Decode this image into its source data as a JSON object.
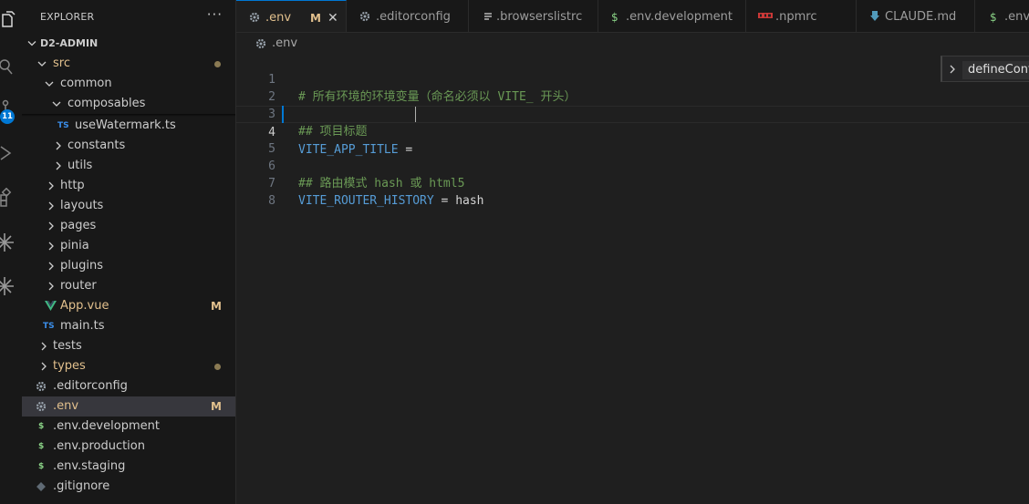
{
  "explorer": {
    "title": "EXPLORER",
    "more": "···",
    "project": "D2-ADMIN",
    "items": [
      {
        "label": "src",
        "modified": false
      },
      {
        "label": "common"
      },
      {
        "label": "composables"
      },
      {
        "label": "useWatermark.ts",
        "icon": "TS"
      },
      {
        "label": "constants"
      },
      {
        "label": "utils"
      },
      {
        "label": "http"
      },
      {
        "label": "layouts"
      },
      {
        "label": "pages"
      },
      {
        "label": "pinia"
      },
      {
        "label": "plugins"
      },
      {
        "label": "router"
      },
      {
        "label": "App.vue",
        "git": "M"
      },
      {
        "label": "main.ts",
        "icon": "TS"
      },
      {
        "label": "tests"
      },
      {
        "label": "types"
      },
      {
        "label": ".editorconfig"
      },
      {
        "label": ".env",
        "git": "M"
      },
      {
        "label": ".env.development",
        "icon": "$"
      },
      {
        "label": ".env.production",
        "icon": "$"
      },
      {
        "label": ".env.staging",
        "icon": "$"
      },
      {
        "label": ".gitignore"
      }
    ]
  },
  "activity": {
    "badge": "11"
  },
  "tabs": [
    {
      "label": ".env",
      "git": "M",
      "close": "✕",
      "icon": "gear-icon"
    },
    {
      "label": ".editorconfig",
      "icon": "gear-icon"
    },
    {
      "label": ".browserslistrc",
      "icon": "list-icon"
    },
    {
      "label": ".env.development",
      "icon": "$"
    },
    {
      "label": ".npmrc",
      "icon": "npm-icon"
    },
    {
      "label": "CLAUDE.md",
      "icon": "download-arrow-icon"
    },
    {
      "label": ".env.",
      "icon": "$"
    }
  ],
  "breadcrumb": {
    "file": ".env"
  },
  "editor": {
    "lines": [
      {
        "num": "1",
        "comment": "# 所有环境的环境变量（命名必须以 VITE_ 开头）"
      },
      {
        "num": "2"
      },
      {
        "num": "3",
        "comment": "## 项目标题"
      },
      {
        "num": "4",
        "var": "VITE_APP_TITLE",
        "rest": " ="
      },
      {
        "num": "5"
      },
      {
        "num": "6",
        "comment": "## 路由模式 hash 或 html5"
      },
      {
        "num": "7",
        "var": "VITE_ROUTER_HISTORY",
        "rest": " = hash"
      },
      {
        "num": "8"
      }
    ]
  },
  "outline_peek": {
    "label": "defineConfig"
  },
  "colors": {
    "accent": "#0078d4",
    "modified": "#e2c08d",
    "comment": "#6a9955",
    "variable": "#569cd6"
  }
}
